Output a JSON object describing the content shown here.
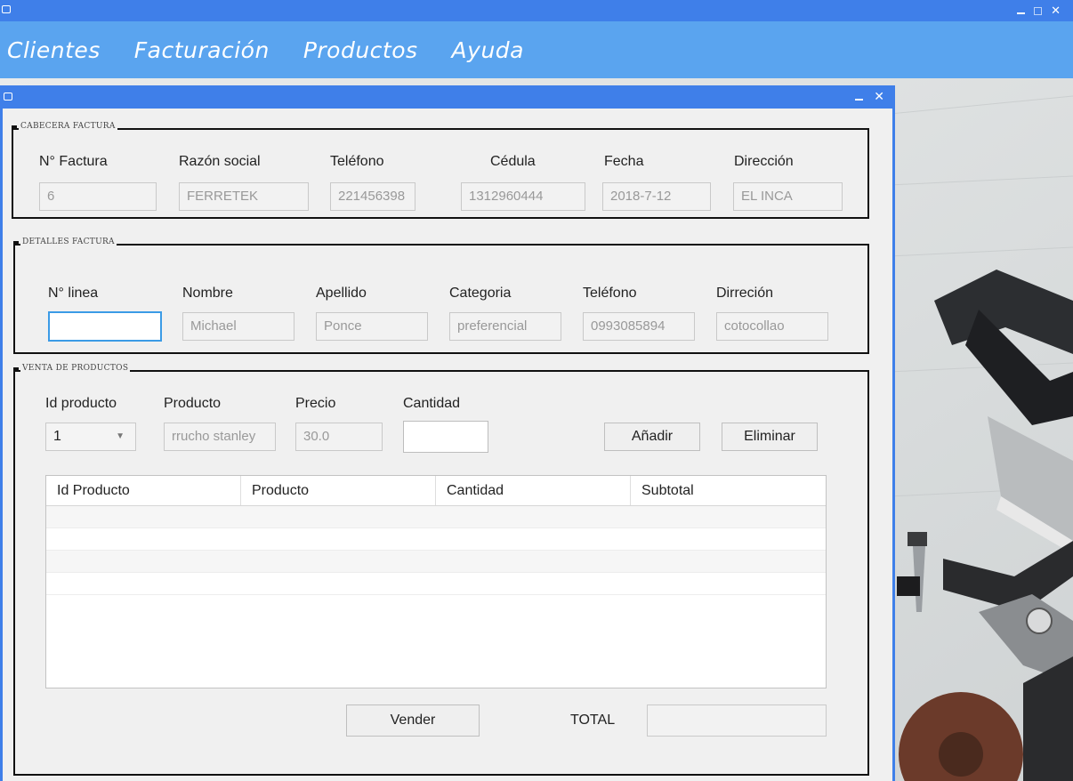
{
  "window": {
    "icon": "window-icon",
    "controls": [
      "minimize-icon",
      "restore-icon",
      "close-icon"
    ]
  },
  "menu": [
    "Clientes",
    "Facturación",
    "Productos",
    "Ayuda"
  ],
  "inner_window": {
    "icon": "window-icon",
    "controls": [
      "minimize-icon",
      "close-icon"
    ]
  },
  "cabecera": {
    "legend": "CABECERA FACTURA",
    "labels": [
      "N° Factura",
      "Razón social",
      "Teléfono",
      "Cédula",
      "Fecha",
      "Dirección"
    ],
    "values": [
      "6",
      "FERRETEK",
      "221456398",
      "1312960444",
      "2018-7-12",
      "EL INCA"
    ]
  },
  "detalles": {
    "legend": "DETALLES FACTURA",
    "labels": [
      "N° linea",
      "Nombre",
      "Apellido",
      "Categoria",
      "Teléfono",
      "Dirreción"
    ],
    "values": [
      "",
      "Michael",
      "Ponce",
      "preferencial",
      "0993085894",
      "cotocollao"
    ]
  },
  "venta": {
    "legend": "VENTA DE PRODUCTOS",
    "labels": [
      "Id producto",
      "Producto",
      "Precio",
      "Cantidad"
    ],
    "id_producto_selected": "1",
    "producto": "rrucho stanley",
    "precio": "30.0",
    "cantidad": "",
    "add_button": "Añadir",
    "delete_button": "Eliminar",
    "table_headers": [
      "Id Producto",
      "Producto",
      "Cantidad",
      "Subtotal"
    ],
    "vender_button": "Vender",
    "total_label": "TOTAL",
    "total_value": ""
  }
}
